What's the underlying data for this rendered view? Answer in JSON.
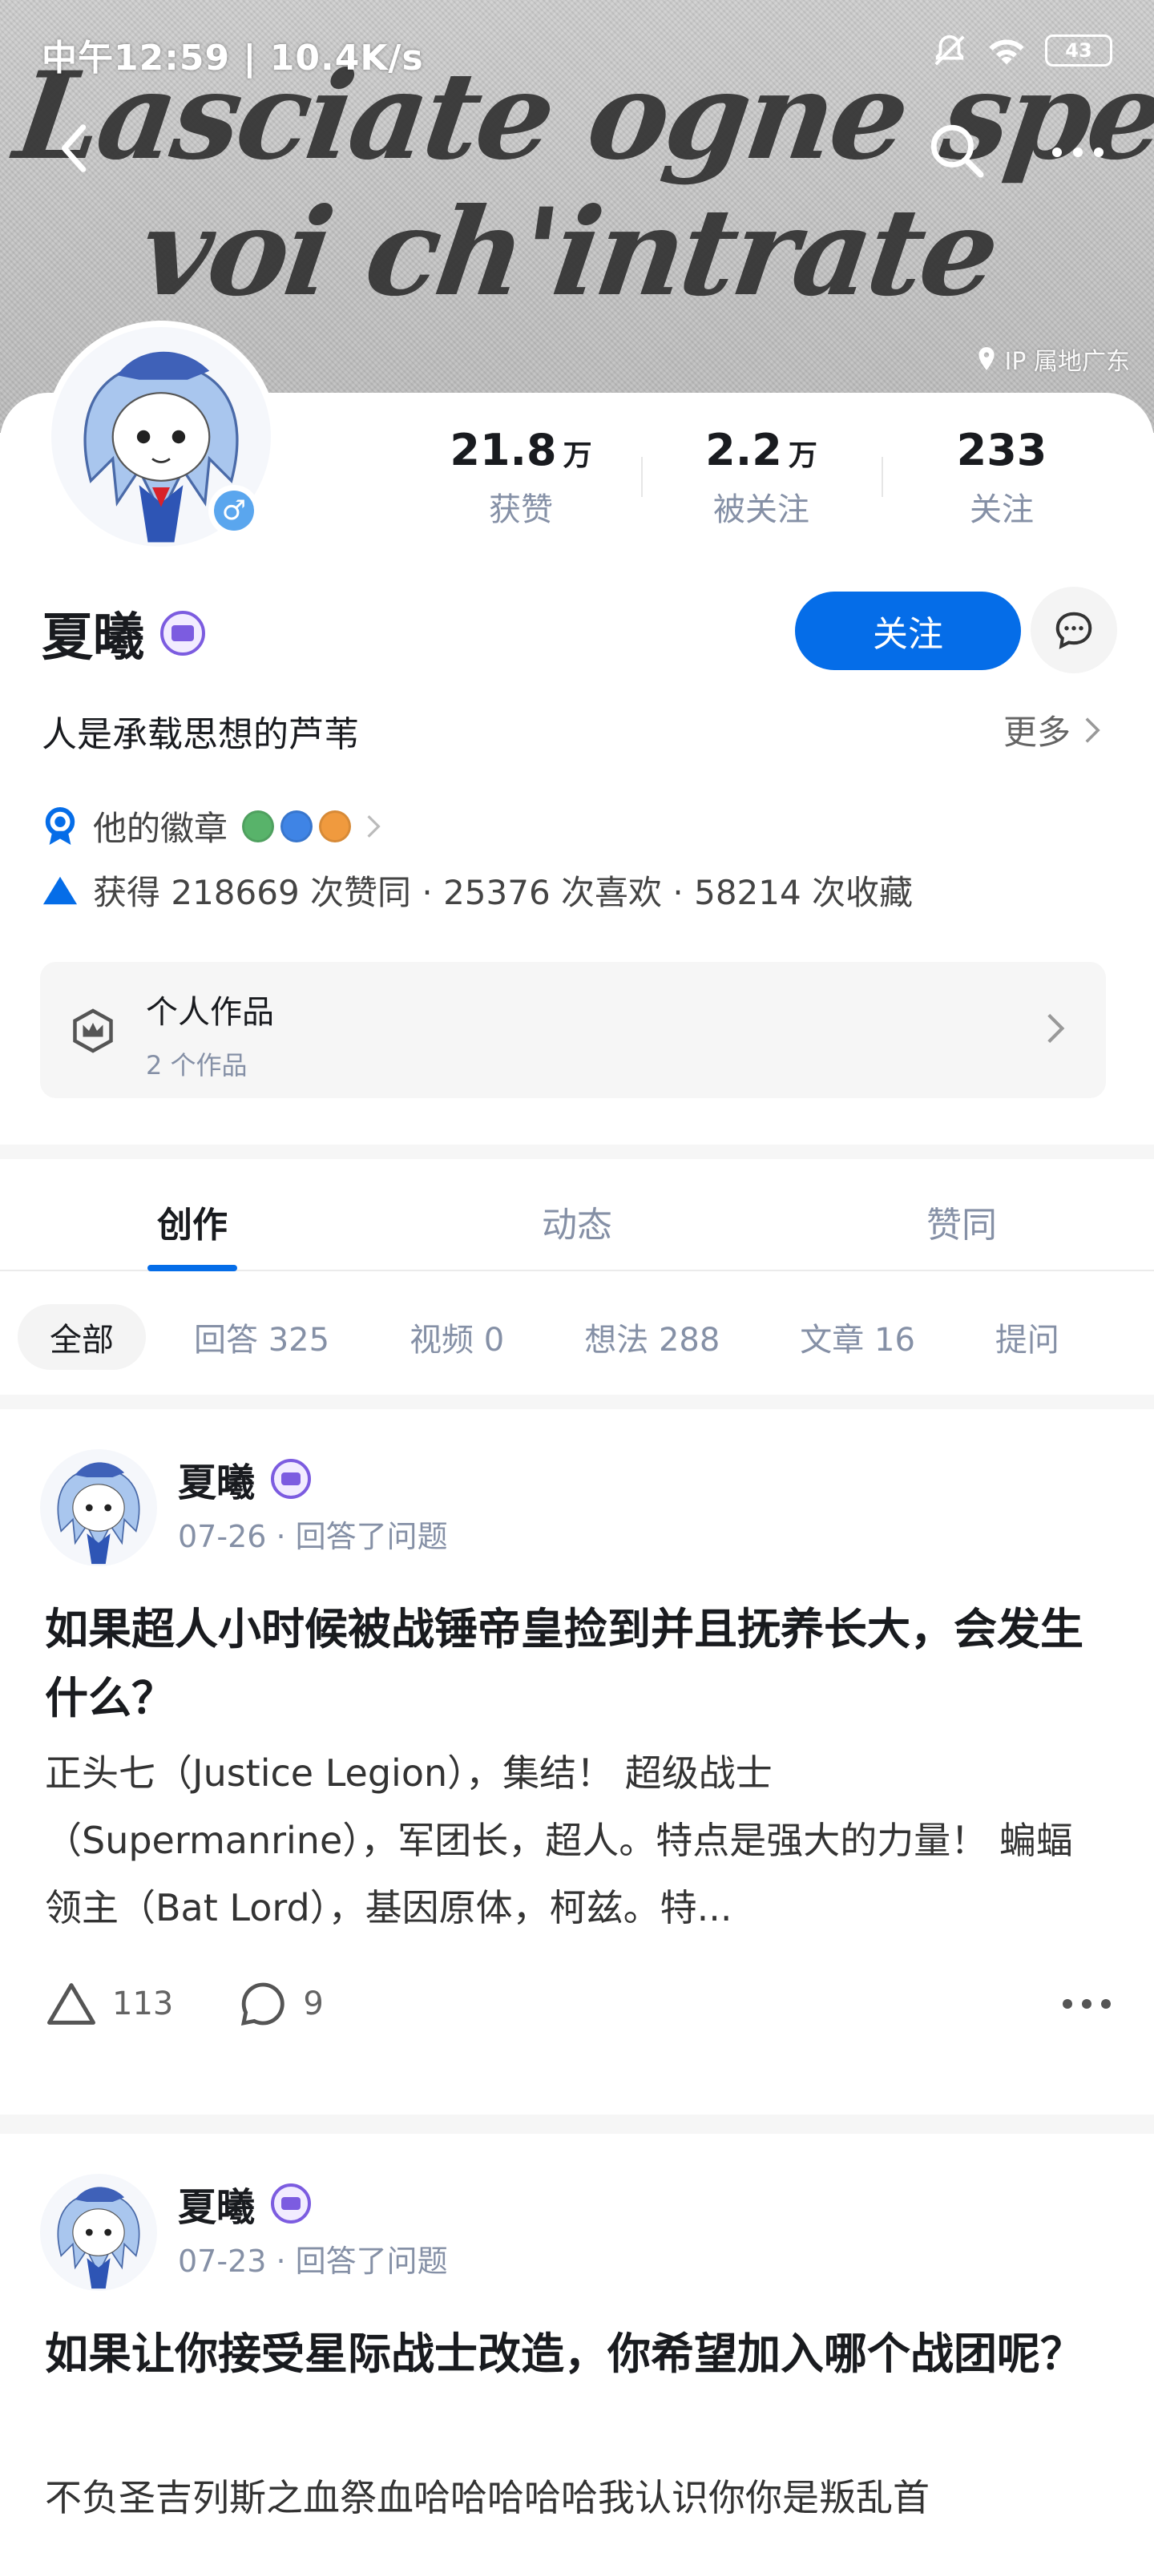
{
  "status_bar": {
    "time": "中午12:59 | 10.4K/s",
    "battery": "43"
  },
  "banner": {
    "script_line1": "Lasciate ogne speranza,",
    "script_line2": "voi ch'intrate",
    "ip_location": "IP 属地广东"
  },
  "profile": {
    "stats": [
      {
        "value": "21.8",
        "unit": "万",
        "label": "获赞"
      },
      {
        "value": "2.2",
        "unit": "万",
        "label": "被关注"
      },
      {
        "value": "233",
        "unit": "",
        "label": "关注"
      }
    ],
    "name": "夏曦",
    "follow_label": "关注",
    "bio": "人是承载思想的芦苇",
    "more_label": "更多",
    "badges_label": "他的徽章",
    "achievements": "获得 218669 次赞同 · 25376 次喜欢 · 58214 次收藏",
    "works_title": "个人作品",
    "works_sub": "2 个作品",
    "gender": "♂"
  },
  "tabs": [
    {
      "label": "创作",
      "active": true
    },
    {
      "label": "动态",
      "active": false
    },
    {
      "label": "赞同",
      "active": false
    }
  ],
  "filters": [
    {
      "label": "全部",
      "active": true
    },
    {
      "label": "回答 325",
      "active": false
    },
    {
      "label": "视频 0",
      "active": false
    },
    {
      "label": "想法 288",
      "active": false
    },
    {
      "label": "文章 16",
      "active": false
    },
    {
      "label": "提问",
      "active": false
    }
  ],
  "feed": [
    {
      "author": "夏曦",
      "meta": "07-26 · 回答了问题",
      "title": "如果超人小时候被战锤帝皇捡到并且抚养长大，会发生什么？",
      "excerpt": "正头七（Justice Legion），集结！ 超级战士（Supermanrine），军团长，超人。特点是强大的力量！ 蝙蝠领主（Bat Lord），基因原体，柯兹。特...",
      "likes": "113",
      "comments": "9"
    },
    {
      "author": "夏曦",
      "meta": "07-23 · 回答了问题",
      "title": "如果让你接受星际战士改造，你希望加入哪个战团呢？",
      "excerpt": "不负圣吉列斯之血祭血哈哈哈哈哈我认识你你是叛乱首",
      "likes": "",
      "comments": ""
    }
  ]
}
